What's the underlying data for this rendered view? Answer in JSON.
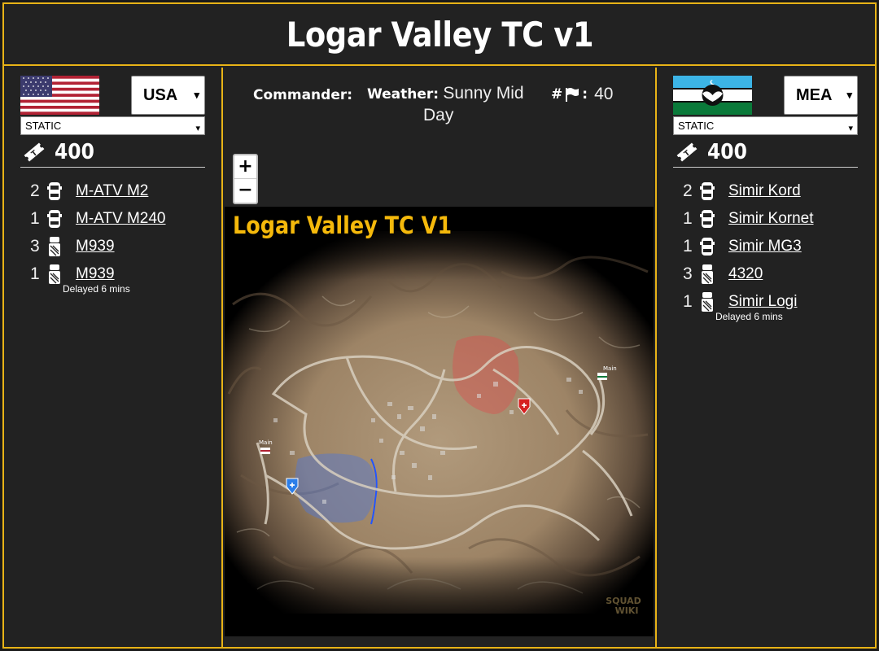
{
  "title": "Logar Valley TC v1",
  "colors": {
    "accent": "#e8b317",
    "background": "#222222",
    "map_title": "#f5b90b",
    "blue_zone": "#5577cc",
    "red_zone": "#d9534f"
  },
  "teams": [
    {
      "faction": "USA",
      "flag": "usa-flag",
      "mode": "STATIC",
      "tickets": "400",
      "units": [
        {
          "count": "2",
          "icon": "car-icon",
          "name": "M-ATV M2"
        },
        {
          "count": "1",
          "icon": "car-icon",
          "name": "M-ATV M240"
        },
        {
          "count": "3",
          "icon": "truck-icon",
          "name": "M939"
        },
        {
          "count": "1",
          "icon": "truck-icon",
          "name": "M939",
          "delay": "Delayed 6 mins"
        }
      ]
    },
    {
      "faction": "MEA",
      "flag": "mea-flag",
      "mode": "STATIC",
      "tickets": "400",
      "units": [
        {
          "count": "2",
          "icon": "car-icon",
          "name": "Simir Kord"
        },
        {
          "count": "1",
          "icon": "car-icon",
          "name": "Simir Kornet"
        },
        {
          "count": "1",
          "icon": "car-icon",
          "name": "Simir MG3"
        },
        {
          "count": "3",
          "icon": "truck-icon",
          "name": "4320"
        },
        {
          "count": "1",
          "icon": "truck-icon",
          "name": "Simir Logi",
          "delay": "Delayed 6 mins"
        }
      ]
    }
  ],
  "info": {
    "commander_label": "Commander:",
    "weather_label": "Weather:",
    "weather_value_1": "Sunny Mid",
    "weather_value_2": "Day",
    "flags_label": "#",
    "flags_sep": ":",
    "flags_value": "40"
  },
  "zoom": {
    "in": "+",
    "out": "−"
  },
  "map": {
    "title": "Logar Valley TC V1",
    "main_label_1": "Main",
    "main_label_2": "Main",
    "watermark_1": "SQUAD",
    "watermark_2": "WIKI"
  }
}
